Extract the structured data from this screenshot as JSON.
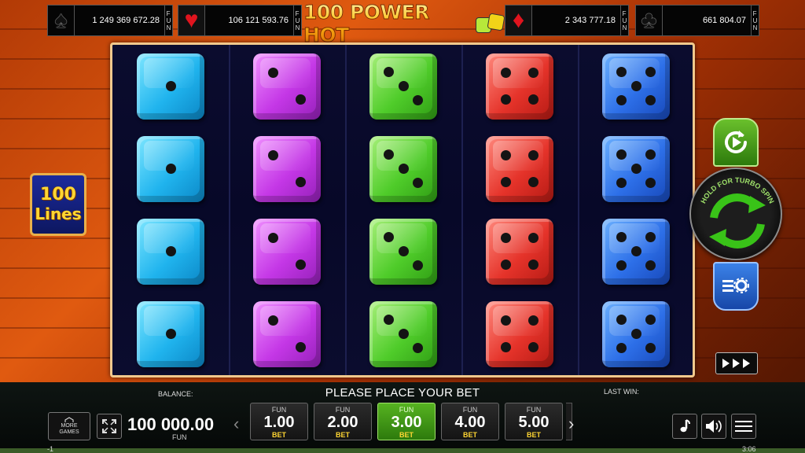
{
  "game": {
    "title": "100 POWER HOT",
    "lines_count": "100",
    "lines_label": "Lines"
  },
  "jackpots": [
    {
      "suit": "spade",
      "value": "1 249 369 672.28",
      "currency": "FUN"
    },
    {
      "suit": "heart",
      "value": "106 121 593.76",
      "currency": "FUN"
    },
    {
      "suit": "diamond",
      "value": "2 343 777.18",
      "currency": "FUN"
    },
    {
      "suit": "club",
      "value": "661 804.07",
      "currency": "FUN"
    }
  ],
  "reels": [
    {
      "color": "cyan",
      "hex": "#20b4ee",
      "faces": [
        1,
        1,
        1,
        1
      ]
    },
    {
      "color": "magenta",
      "hex": "#c437e6",
      "faces": [
        2,
        2,
        2,
        2
      ]
    },
    {
      "color": "green",
      "hex": "#4fcc2a",
      "faces": [
        3,
        3,
        3,
        3
      ]
    },
    {
      "color": "red",
      "hex": "#e5332a",
      "faces": [
        4,
        4,
        4,
        4
      ]
    },
    {
      "color": "blue",
      "hex": "#2d6fe8",
      "faces": [
        5,
        5,
        5,
        5
      ]
    }
  ],
  "controls": {
    "spin_hint": "HOLD FOR TURBO SPIN",
    "autoplay_icon": "autoplay-icon",
    "spin_icon": "spin-arrows-icon",
    "settings_icon": "settings-icon",
    "quickspin_icon": "fast-forward-icon"
  },
  "bottom": {
    "balance_label": "BALANCE:",
    "status_message": "PLEASE PLACE YOUR BET",
    "last_win_label": "LAST WIN:",
    "balance_value": "100 000.00",
    "balance_currency": "FUN",
    "more_games_label_1": "MORE",
    "more_games_label_2": "GAMES",
    "bet_options": [
      {
        "currency": "FUN",
        "value": "1.00",
        "label": "BET",
        "selected": false
      },
      {
        "currency": "FUN",
        "value": "2.00",
        "label": "BET",
        "selected": false
      },
      {
        "currency": "FUN",
        "value": "3.00",
        "label": "BET",
        "selected": true
      },
      {
        "currency": "FUN",
        "value": "4.00",
        "label": "BET",
        "selected": false
      },
      {
        "currency": "FUN",
        "value": "5.00",
        "label": "BET",
        "selected": false
      }
    ],
    "footer_left": "-1",
    "clock": "3:06"
  },
  "colors": {
    "accent_green": "#56b321",
    "accent_gold": "#ffd633",
    "frame_border": "#f1c98d"
  }
}
